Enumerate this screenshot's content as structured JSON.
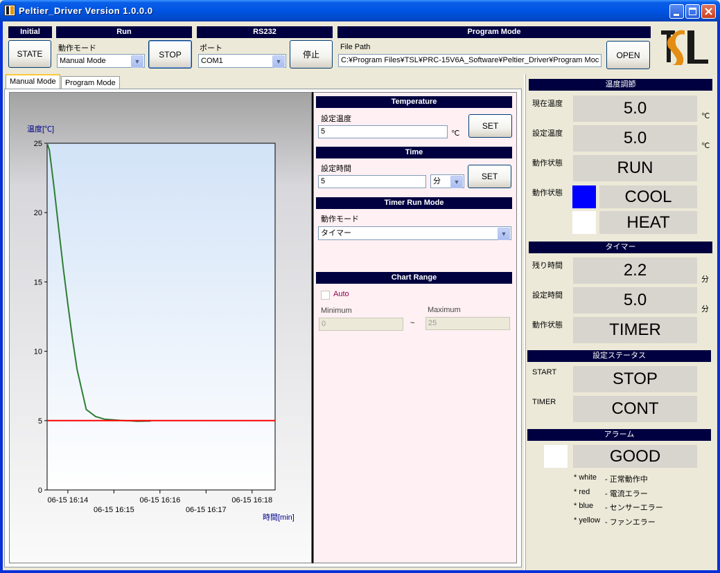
{
  "window": {
    "title": "Peltier_Driver Version 1.0.0.0"
  },
  "toolbar": {
    "initial": {
      "header": "Initial",
      "state_button": "STATE"
    },
    "run": {
      "header": "Run",
      "mode_label": "動作モード",
      "mode_value": "Manual Mode",
      "stop_button": "STOP"
    },
    "rs232": {
      "header": "RS232",
      "port_label": "ポート",
      "port_value": "COM1",
      "stop_button": "停止"
    },
    "program_mode": {
      "header": "Program Mode",
      "file_path_label": "File Path",
      "file_path_value": "C:¥Program Files¥TSL¥PRC-15V6A_Software¥Peltier_Driver¥Program Moc",
      "open_button": "OPEN"
    }
  },
  "tabs": [
    {
      "label": "Manual Mode",
      "active": true
    },
    {
      "label": "Program Mode",
      "active": false
    }
  ],
  "chart_data": {
    "type": "line",
    "ylabel": "温度[℃]",
    "xlabel": "時間[min]",
    "ylim": [
      0,
      25
    ],
    "yticks": [
      "0",
      "5",
      "10",
      "15",
      "20",
      "25"
    ],
    "xticks_upper": [
      "06-15 16:14",
      "06-15 16:16",
      "06-15 16:18"
    ],
    "xticks_lower": [
      "06-15 16:15",
      "06-15 16:17"
    ],
    "xlim_min": [
      13.55,
      18.5
    ],
    "series": [
      {
        "color": "#2e7d32",
        "x": [
          13.55,
          13.6,
          13.7,
          13.8,
          13.9,
          14.0,
          14.1,
          14.2,
          14.4,
          14.6,
          14.8,
          15.0,
          15.2,
          15.4,
          15.5,
          15.8
        ],
        "y": [
          25.0,
          24.5,
          21.8,
          18.9,
          16.0,
          13.4,
          10.9,
          8.7,
          5.8,
          5.3,
          5.1,
          5.05,
          5.0,
          4.98,
          4.95,
          4.97
        ]
      },
      {
        "color": "#ff0000",
        "x": [
          13.55,
          18.5
        ],
        "y": [
          5,
          5
        ]
      }
    ]
  },
  "controls": {
    "temperature": {
      "header": "Temperature",
      "label": "設定温度",
      "value": "5",
      "unit": "℃",
      "set_button": "SET"
    },
    "time": {
      "header": "Time",
      "label": "設定時間",
      "value": "5",
      "unit_value": "分",
      "set_button": "SET"
    },
    "timer_run_mode": {
      "header": "Timer Run Mode",
      "label": "動作モード",
      "value": "タイマー"
    },
    "chart_range": {
      "header": "Chart Range",
      "auto_label": "Auto",
      "min_label": "Minimum",
      "max_label": "Maximum",
      "min_value": "0",
      "max_value": "25",
      "separator": "~"
    }
  },
  "status": {
    "temp_control": {
      "header": "温度調節",
      "current_label": "現在温度",
      "current_value": "5.0",
      "current_unit": "℃",
      "set_label": "設定温度",
      "set_value": "5.0",
      "set_unit": "℃",
      "state_label": "動作状態",
      "state_value": "RUN",
      "mode_label": "動作状態",
      "cool_label": "COOL",
      "heat_label": "HEAT",
      "cool_color": "#0000ff",
      "heat_color": "#ffffff"
    },
    "timer": {
      "header": "タイマー",
      "remaining_label": "残り時間",
      "remaining_value": "2.2",
      "remaining_unit": "分",
      "set_label": "設定時間",
      "set_value": "5.0",
      "set_unit": "分",
      "state_label": "動作状態",
      "state_value": "TIMER"
    },
    "settings_status": {
      "header": "設定ステータス",
      "start_label": "START",
      "start_value": "STOP",
      "timer_label": "TIMER",
      "timer_value": "CONT"
    },
    "alarm": {
      "header": "アラーム",
      "value": "GOOD",
      "indicator_color": "#ffffff",
      "legend": [
        {
          "key": "* white",
          "desc": "- 正常動作中"
        },
        {
          "key": "* red",
          "desc": "- 電流エラー"
        },
        {
          "key": "* blue",
          "desc": "- センサーエラー"
        },
        {
          "key": "* yellow",
          "desc": "- ファンエラー"
        }
      ]
    }
  }
}
